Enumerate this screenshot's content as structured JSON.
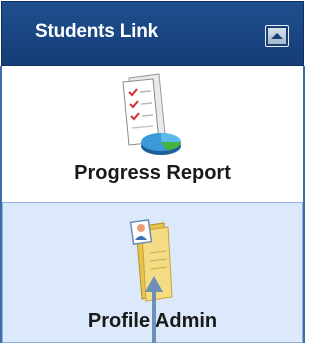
{
  "header": {
    "title": "Students Link",
    "collapse_icon": "chevron-up-icon"
  },
  "items": [
    {
      "label": "Progress Report",
      "icon": "report-chart-icon",
      "selected": false
    },
    {
      "label": "Profile Admin",
      "icon": "profile-folder-icon",
      "selected": true
    }
  ],
  "colors": {
    "header": "#1f4f8f",
    "selected_bg": "#dce9fb",
    "arrow": "#6d8fb8"
  }
}
